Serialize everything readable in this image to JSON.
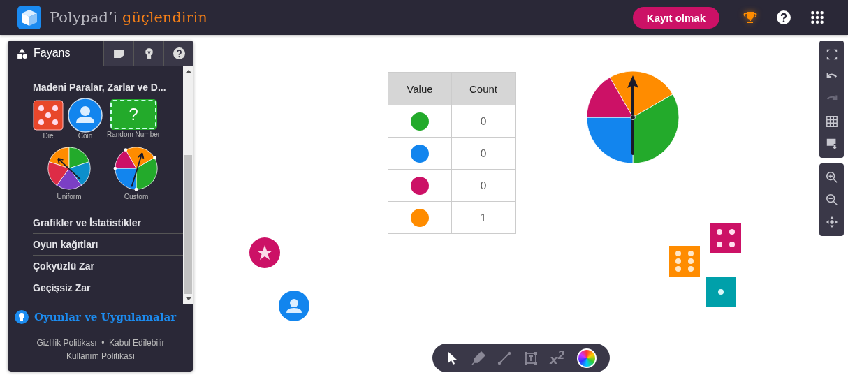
{
  "header": {
    "title": "Polypad’i",
    "title_highlight": "güçlendirin",
    "signup_button": "Kayıt olmak",
    "actions": [
      {
        "kind": "trophy"
      },
      {
        "kind": "help"
      },
      {
        "kind": "apps"
      }
    ]
  },
  "sidebar": {
    "tabs": [
      {
        "kind": "tiles",
        "label": "Fayans",
        "selected": true
      },
      {
        "kind": "note",
        "selected": false
      },
      {
        "kind": "bulb",
        "selected": false
      },
      {
        "kind": "help",
        "selected": false
      }
    ],
    "section_title": "Madeni Paralar, Zarlar ve D...",
    "tiles": [
      {
        "kind": "die",
        "label": "Die"
      },
      {
        "kind": "coin",
        "label": "Coin"
      },
      {
        "kind": "random",
        "label": "Random Number",
        "symbol": "?"
      },
      {
        "kind": "uniform",
        "label": "Uniform"
      },
      {
        "kind": "custom",
        "label": "Custom"
      }
    ],
    "categories": [
      "Grafikler ve İstatistikler",
      "Oyun kağıtları",
      "Çokyüzlü Zar",
      "Geçişsiz Zar"
    ],
    "games_link": "Oyunlar ve Uygulamalar",
    "footer": {
      "link_1": "Gizlilik Politikası",
      "separator": "•",
      "link_2": "Kabul Edilebilir Kullanım Politikası"
    }
  },
  "table": {
    "columns": [
      "Value",
      "Count"
    ],
    "rows": [
      {
        "color": "#23aa2b",
        "count": "0"
      },
      {
        "color": "#1285ee",
        "count": "0"
      },
      {
        "color": "#cc1166",
        "count": "0"
      },
      {
        "color": "#ff8c00",
        "count": "1"
      }
    ]
  },
  "right_toolbar": [
    [
      {
        "kind": "fullscreen",
        "disabled": false
      },
      {
        "kind": "undo",
        "disabled": false
      },
      {
        "kind": "redo",
        "disabled": true
      },
      {
        "kind": "grid",
        "disabled": false
      },
      {
        "kind": "export",
        "disabled": false
      }
    ],
    [
      {
        "kind": "zoom-in",
        "disabled": false
      },
      {
        "kind": "zoom-out",
        "disabled": false
      },
      {
        "kind": "pan",
        "disabled": false
      }
    ]
  ],
  "bottom_toolbar": [
    {
      "kind": "pointer",
      "selected": true
    },
    {
      "kind": "pen",
      "selected": false
    },
    {
      "kind": "line",
      "selected": false
    },
    {
      "kind": "text",
      "selected": false
    },
    {
      "kind": "equation",
      "label": "x$^{2}$",
      "selected": false
    },
    {
      "kind": "color",
      "selected": false
    }
  ]
}
